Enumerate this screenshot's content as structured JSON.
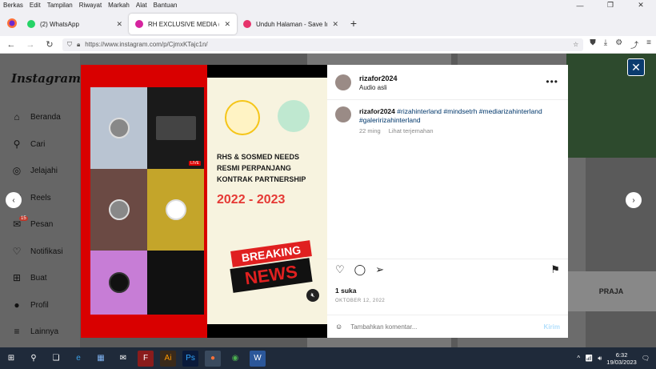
{
  "menubar": [
    "Berkas",
    "Edit",
    "Tampilan",
    "Riwayat",
    "Markah",
    "Alat",
    "Bantuan"
  ],
  "tabs": [
    {
      "label": "(2) WhatsApp",
      "icon": "whatsapp-icon",
      "color": "#25d366",
      "active": false
    },
    {
      "label": "RH EXCLUSIVE MEDIA (@rizafor",
      "icon": "instagram-icon",
      "color": "#d6249f",
      "active": true
    },
    {
      "label": "Unduh Halaman - Save Insta",
      "icon": "heart-icon",
      "color": "#e6336b",
      "active": false
    }
  ],
  "url": "https://www.instagram.com/p/CjmxKTajc1n/",
  "sidebar": {
    "logo": "Instagram",
    "items": [
      {
        "label": "Beranda",
        "icon": "⌂"
      },
      {
        "label": "Cari",
        "icon": "⚲"
      },
      {
        "label": "Jelajahi",
        "icon": "◎"
      },
      {
        "label": "Reels",
        "icon": "▣"
      },
      {
        "label": "Pesan",
        "icon": "✉",
        "badge": "15"
      },
      {
        "label": "Notifikasi",
        "icon": "♡"
      },
      {
        "label": "Buat",
        "icon": "⊞"
      },
      {
        "label": "Profil",
        "icon": "●"
      },
      {
        "label": "Lainnya",
        "icon": "≡"
      }
    ]
  },
  "post": {
    "author": "rizafor2024",
    "audio": "Audio asli",
    "caption_author": "rizafor2024",
    "caption_text": "#rizahinterland #mindsetrh #mediarizahinterland #galeririzahinterland",
    "time": "22 ming",
    "translate": "Lihat terjemahan",
    "likes": "1 suka",
    "date": "OKTOBER 12, 2022",
    "comment_placeholder": "Tambahkan komentar...",
    "post_label": "Kirim"
  },
  "poster": {
    "line1": "RHS & SOSMED NEEDS",
    "line2": "RESMI PERPANJANG",
    "line3": "KONTRAK PARTNERSHIP",
    "year": "2022 - 2023",
    "breaking": "BREAKING",
    "news": "NEWS",
    "live": "LIVE"
  },
  "background": {
    "praja": "PRAJA"
  },
  "clock": {
    "time": "6:32",
    "date": "19/03/2023"
  }
}
